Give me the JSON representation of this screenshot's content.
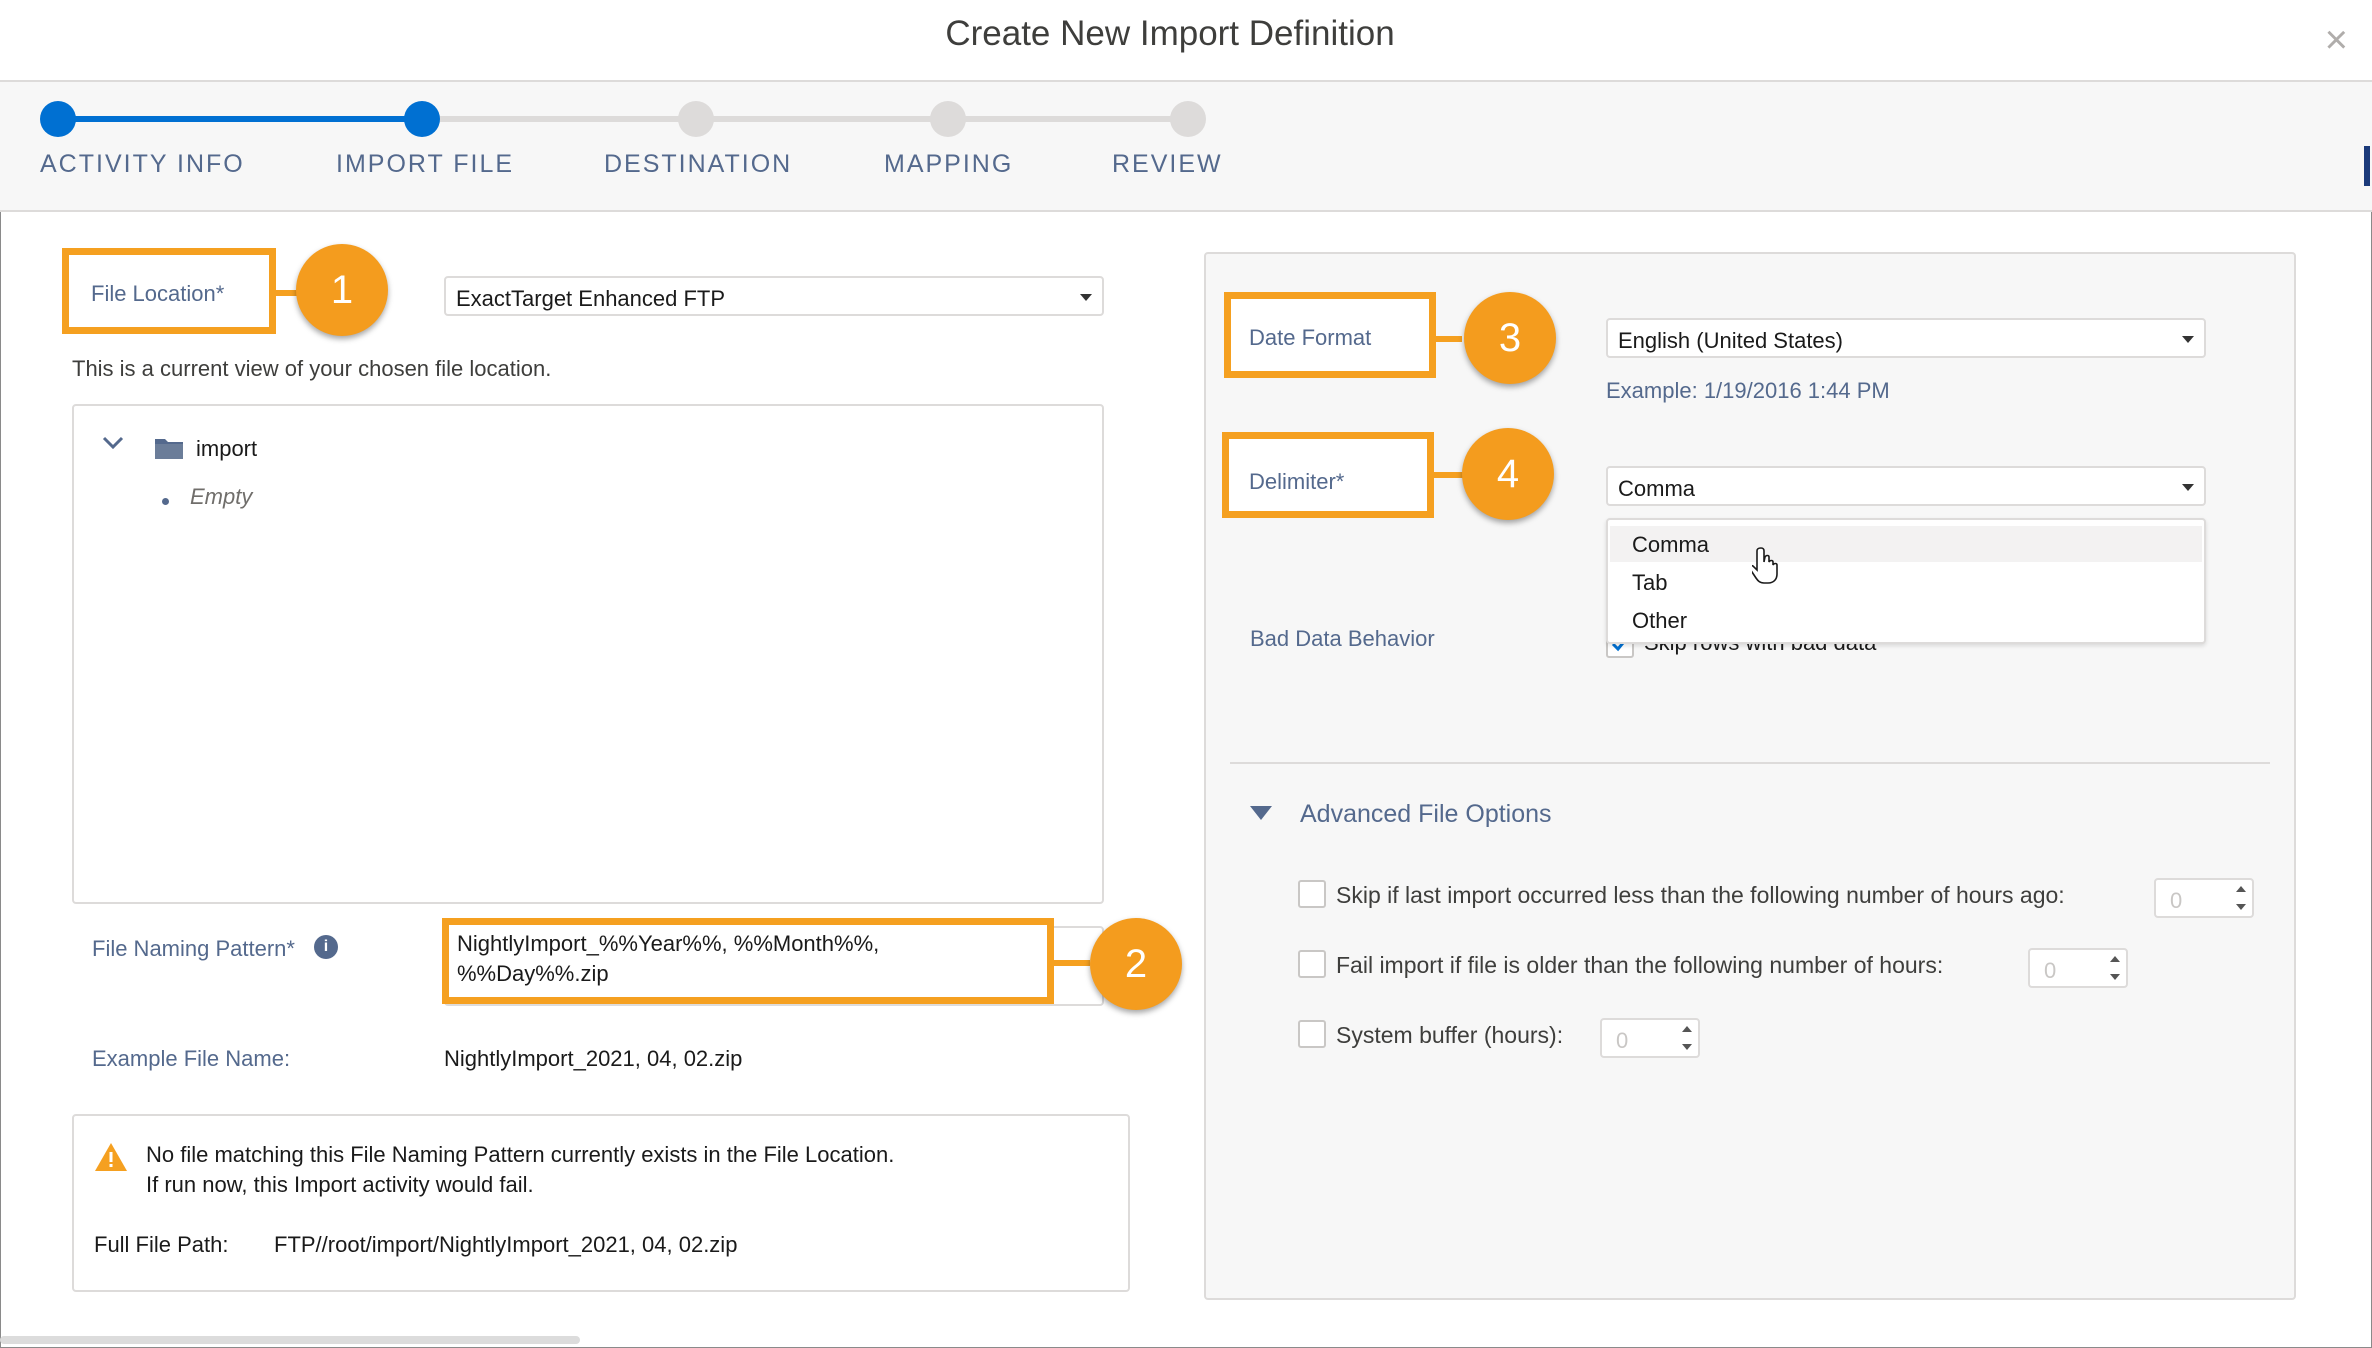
{
  "dialog": {
    "title": "Create New Import Definition",
    "close_icon": "close-icon"
  },
  "progress": {
    "steps": [
      {
        "label": "ACTIVITY INFO",
        "state": "complete"
      },
      {
        "label": "IMPORT FILE",
        "state": "current"
      },
      {
        "label": "DESTINATION",
        "state": "upcoming"
      },
      {
        "label": "MAPPING",
        "state": "upcoming"
      },
      {
        "label": "REVIEW",
        "state": "upcoming"
      }
    ],
    "colors": {
      "active": "#0070d2",
      "inactive": "#dddbda"
    }
  },
  "callouts": [
    "1",
    "2",
    "3",
    "4"
  ],
  "left": {
    "file_location_label": "File Location*",
    "file_location_value": "ExactTarget Enhanced FTP",
    "current_view_text": "This is a current view of your chosen file location.",
    "tree": {
      "folder": "import",
      "folder_icon": "folder-icon",
      "empty_label": "Empty"
    },
    "naming_pattern_label": "File Naming Pattern*",
    "naming_pattern_value": "NightlyImport_%%Year%%, %%Month%%, %%Day%%.zip",
    "example_label": "Example File Name:",
    "example_value": "NightlyImport_2021, 04, 02.zip",
    "warning": {
      "line1": "No file matching this File Naming Pattern currently exists in the File Location.",
      "line2": "If run now, this Import activity would fail.",
      "path_label": "Full File Path:",
      "path_value": "FTP//root/import/NightlyImport_2021, 04, 02.zip"
    }
  },
  "right": {
    "date_format_label": "Date Format",
    "date_format_value": "English (United States)",
    "date_example": "Example: 1/19/2016 1:44 PM",
    "delimiter_label": "Delimiter*",
    "delimiter_value": "Comma",
    "delimiter_options": [
      "Comma",
      "Tab",
      "Other"
    ],
    "bad_data_label": "Bad Data Behavior",
    "bad_data_value": "Skip rows with bad data",
    "advanced_title": "Advanced File Options",
    "options": [
      {
        "label": "Skip if last import occurred less than the following number of hours ago:",
        "value": "0"
      },
      {
        "label": "Fail import if file is older than the following number of hours:",
        "value": "0"
      },
      {
        "label": "System buffer (hours):",
        "value": "0"
      }
    ]
  },
  "accent_color": "#f5a020"
}
